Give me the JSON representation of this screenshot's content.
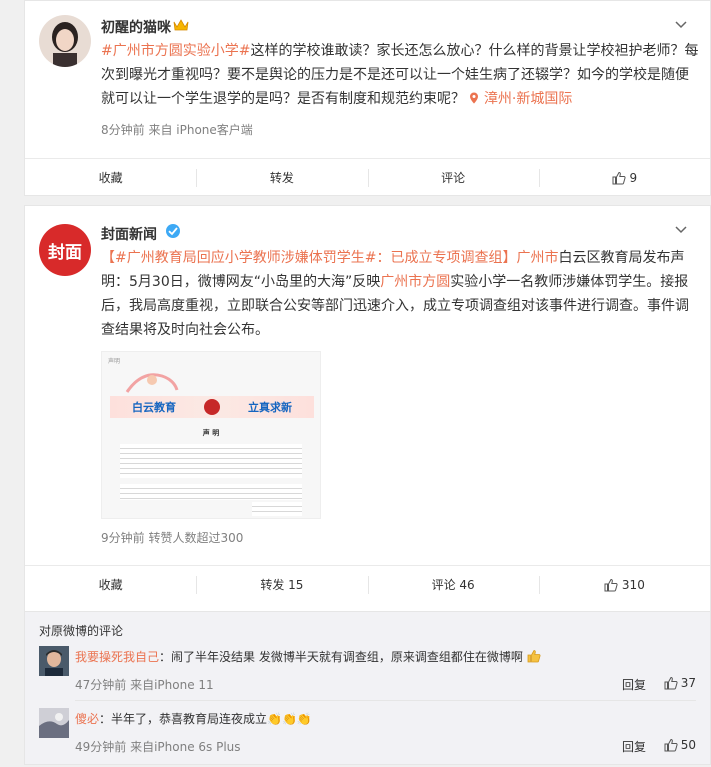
{
  "post1": {
    "username": "初醒的猫咪",
    "text_link": "#广州市方圆实验小学#",
    "text_body": "这样的学校谁敢读？家长还怎么放心？什么样的背景让学校袒护老师？每次到曝光才重视吗？要不是舆论的压力是不是还可以让一个娃生病了还辍学？如今的学校是随便就可以让一个学生退学的是吗？是否有制度和规范约束呢？",
    "location": "漳州·新城国际",
    "meta": "8分钟前  来自 iPhone客户端",
    "actions": {
      "fav": "收藏",
      "repost": "转发",
      "comment": "评论",
      "like": "9"
    }
  },
  "post2": {
    "username": "封面新闻",
    "avatar_text": "封面",
    "text_tag": "【#广州教育局回应小学教师涉嫌体罚学生#：已成立专项调查组】",
    "text_place": "广州市",
    "text_a": "白云区教育局发布声明：5月30日，微博网友“小岛里的大海”反映",
    "text_school": "广州市方圆",
    "text_b": "实验小学一名教师涉嫌体罚学生。接报后，我局高度重视，立即联合公安等部门迅速介入，成立专项调查组对该事件进行调查。事件调查结果将及时向社会公布。",
    "image": {
      "doc_title": "声明",
      "banner_left": "白云教育",
      "banner_right": "立真求新",
      "heading": "声 明"
    },
    "meta": "9分钟前  转赞人数超过300",
    "actions": {
      "fav": "收藏",
      "repost": "转发 15",
      "comment": "评论 46",
      "like": "310"
    }
  },
  "comments": {
    "title": "对原微博的评论",
    "items": [
      {
        "user": "我要操死我自己",
        "text": "：闹了半年没结果 发微博半天就有调查组，原来调查组都住在微博啊",
        "meta": "47分钟前  来自iPhone 11",
        "reply": "回复",
        "likes": "37"
      },
      {
        "user": "傻必",
        "text": "：半年了，恭喜教育局连夜成立👏👏👏",
        "meta": "49分钟前  来自iPhone 6s Plus",
        "reply": "回复",
        "likes": "50"
      }
    ]
  },
  "colors": {
    "link": "#eb7350",
    "brand_red": "#d82a2a",
    "vip_gold": "#f7b500",
    "verified": "#3da9f5"
  }
}
